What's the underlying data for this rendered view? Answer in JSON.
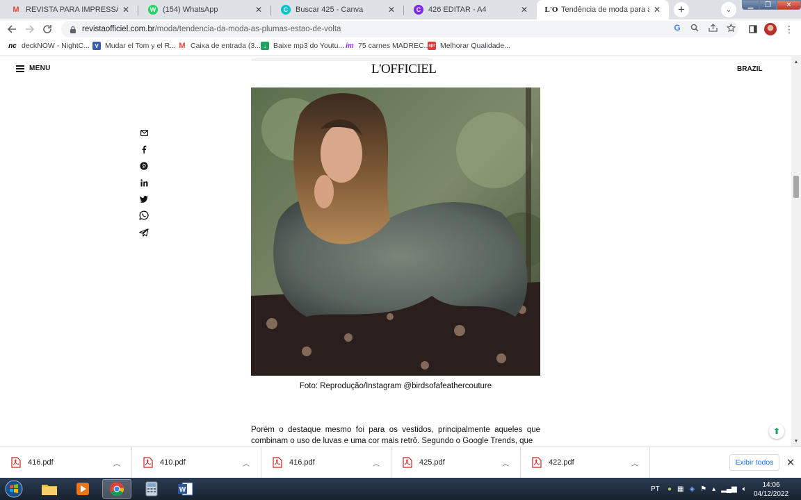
{
  "tabs": [
    {
      "label": "REVISTA PARA IMPRESSÃO - con",
      "icon": "gmail-icon",
      "active": false
    },
    {
      "label": "(154) WhatsApp",
      "icon": "whatsapp-icon",
      "active": false
    },
    {
      "label": "Buscar 425 - Canva",
      "icon": "canva-icon",
      "active": false
    },
    {
      "label": "426 EDITAR - A4",
      "icon": "canva-icon",
      "active": false
    },
    {
      "label": "Tendência de moda para apostar",
      "icon": "lofficiel-icon",
      "active": true
    }
  ],
  "address_bar": {
    "domain": "revistaofficiel.com.br",
    "path": "/moda/tendencia-da-moda-as-plumas-estao-de-volta"
  },
  "bookmarks": [
    {
      "label": "deckNOW - NightC...",
      "icon": "decknow-icon",
      "color": "#000000"
    },
    {
      "label": "Mudar el Tom y el R...",
      "icon": "v-icon",
      "color": "#3b5bab"
    },
    {
      "label": "Caixa de entrada (3...",
      "icon": "gmail-icon",
      "color": "#ea4335"
    },
    {
      "label": "Baixe mp3 do Youtu...",
      "icon": "download-icon",
      "color": "#1ea362"
    },
    {
      "label": "75 carnes MADREC...",
      "icon": "im-icon",
      "color": "#8a2be2"
    },
    {
      "label": "Melhorar Qualidade...",
      "icon": "app-icon",
      "color": "#e53935"
    }
  ],
  "site": {
    "menu_label": "MENU",
    "logo": "L'OFFICIEL",
    "region": "BRAZIL"
  },
  "share_icons": [
    "email-icon",
    "facebook-icon",
    "pinterest-icon",
    "linkedin-icon",
    "twitter-icon",
    "whatsapp-icon",
    "telegram-icon"
  ],
  "article": {
    "caption": "Foto: Reprodução/Instagram @birdsofafeathercouture",
    "paragraph": "Porém o destaque mesmo foi para os vestidos, principalmente aqueles que combinam o uso de luvas e uma cor mais retrô. Segundo o Google Trends, que"
  },
  "downloads": [
    {
      "name": "416.pdf"
    },
    {
      "name": "410.pdf"
    },
    {
      "name": "416.pdf"
    },
    {
      "name": "425.pdf"
    },
    {
      "name": "422.pdf"
    }
  ],
  "show_all_label": "Exibir todos",
  "taskbar": {
    "apps": [
      "explorer-icon",
      "media-player-icon",
      "chrome-icon",
      "calculator-icon",
      "word-icon"
    ],
    "language": "PT",
    "time": "14:06",
    "date": "04/12/2022"
  }
}
